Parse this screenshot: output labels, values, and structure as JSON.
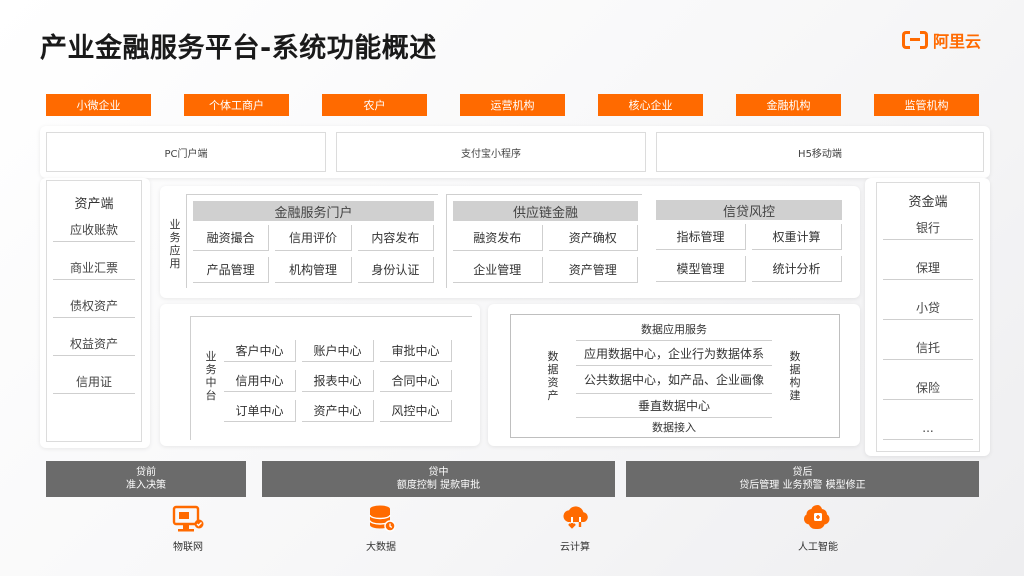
{
  "header": {
    "title": "产业金融服务平台-系统功能概述",
    "logo_text": "阿里云",
    "accent_color": "#ff6a00"
  },
  "users": [
    "小微企业",
    "个体工商户",
    "农户",
    "运营机构",
    "核心企业",
    "金融机构",
    "监管机构"
  ],
  "entry_points": [
    "PC门户端",
    "支付宝小程序",
    "H5移动端"
  ],
  "asset_side": {
    "title": "资产端",
    "items": [
      "应收账款",
      "商业汇票",
      "债权资产",
      "权益资产",
      "信用证"
    ]
  },
  "fund_side": {
    "title": "资金端",
    "items": [
      "银行",
      "保理",
      "小贷",
      "信托",
      "保险",
      "..."
    ]
  },
  "business_app": {
    "label": "业务应用",
    "groups": [
      {
        "title": "金融服务门户",
        "items": [
          "融资撮合",
          "信用评价",
          "内容发布",
          "产品管理",
          "机构管理",
          "身份认证"
        ]
      },
      {
        "title": "供应链金融",
        "items": [
          "融资发布",
          "资产确权",
          "企业管理",
          "资产管理"
        ]
      },
      {
        "title": "信贷风控",
        "items": [
          "指标管理",
          "权重计算",
          "模型管理",
          "统计分析"
        ]
      }
    ]
  },
  "middle_platform": {
    "label": "业务中台",
    "items": [
      "客户中心",
      "账户中心",
      "审批中心",
      "信用中心",
      "报表中心",
      "合同中心",
      "订单中心",
      "资产中心",
      "风控中心"
    ]
  },
  "data_section": {
    "left_label": "数据资产",
    "right_label": "数据构建",
    "rows": [
      "数据应用服务",
      "应用数据中心，企业行为数据体系",
      "公共数据中心，如产品、企业画像",
      "垂直数据中心",
      "数据接入"
    ]
  },
  "stages": [
    {
      "title": "贷前",
      "desc": "准入决策"
    },
    {
      "title": "贷中",
      "desc": "额度控制  提款审批"
    },
    {
      "title": "贷后",
      "desc": "贷后管理  业务预警  模型修正"
    }
  ],
  "technologies": [
    {
      "label": "物联网",
      "icon": "iot-monitor-icon"
    },
    {
      "label": "大数据",
      "icon": "big-data-icon"
    },
    {
      "label": "云计算",
      "icon": "cloud-computing-icon"
    },
    {
      "label": "人工智能",
      "icon": "ai-brain-icon"
    }
  ]
}
